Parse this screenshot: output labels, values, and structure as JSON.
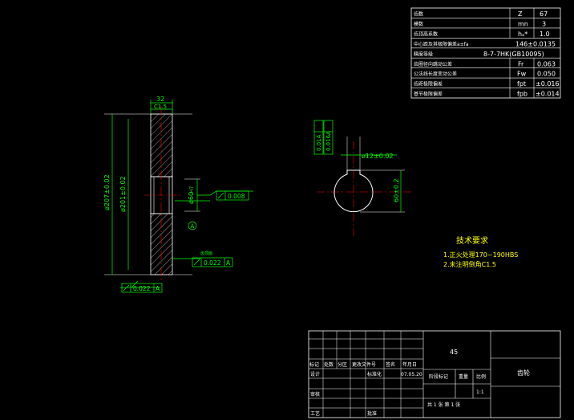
{
  "params": [
    {
      "name": "齿数",
      "sym": "Z",
      "val": "67"
    },
    {
      "name": "模数",
      "sym": "mn",
      "val": "3"
    },
    {
      "name": "齿顶高系数",
      "sym": "hₐ*",
      "val": "1.0"
    },
    {
      "name": "中心距及其极限偏差a±fa",
      "sym": "",
      "val": "146±0.0135"
    },
    {
      "name": "精度等级",
      "sym": "",
      "val": "8-7-7HK(GB10095)"
    },
    {
      "name": "齿圈径向跳动公差",
      "sym": "Fr",
      "val": "0.063"
    },
    {
      "name": "公法线长度变动公差",
      "sym": "Fw",
      "val": "0.050"
    },
    {
      "name": "齿距极限偏差",
      "sym": "fpt",
      "val": "±0.016"
    },
    {
      "name": "基节极限偏差",
      "sym": "fpb",
      "val": "±0.014"
    }
  ],
  "dims": {
    "width_top": "32",
    "chamfer_top": "C1.5",
    "od": "ø207±0.02",
    "pd": "ø201±0.02",
    "bore": "ø60",
    "bore_sym": "H7",
    "keyway_w": "ø12±0.02",
    "keyway_d": "60±0.2",
    "key_tol_a": "0.01A",
    "key_tol_b": "0.016A",
    "datum": "A",
    "runout_side": "0.008",
    "runout_face": "0.022",
    "runout_face_ref": "A",
    "runout_bottom": "0.022",
    "runout_bottom_ref": "A",
    "small_note": "齿顶面"
  },
  "tech": {
    "title": "技术要求",
    "items": [
      "1.正火处理170~190HBS",
      "2.未注明倒角C1.5"
    ]
  },
  "titleblock": {
    "material": "45",
    "part_name": "齿轮",
    "headers": [
      "标记",
      "处数",
      "分区",
      "更改文件号",
      "签名",
      "年月日"
    ],
    "row_design": "设计",
    "row_std": "标准化",
    "date": "07.05.20",
    "stage_mark": "阶段标记",
    "weight": "重量",
    "scale": "比例",
    "scale_val": "1:1",
    "row_check": "审核",
    "row_process": "工艺",
    "row_approve": "批准",
    "sheets": "共 1 张  第 1 张"
  }
}
